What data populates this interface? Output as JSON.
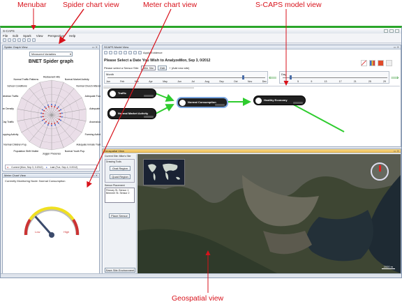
{
  "callouts": {
    "menubar": "Menubar",
    "spider": "Spider chart view",
    "meter": "Meter chart view",
    "scaps": "S-CAPS model view",
    "geo": "Geospatial view"
  },
  "app": {
    "title": "S-CAPS"
  },
  "menu": [
    "File",
    "Edit",
    "Spark",
    "View",
    "Perspective",
    "Help"
  ],
  "spider": {
    "panel_title": "Spider Graph View",
    "dropdown": "Measured Variables",
    "title": "BNET Spider graph",
    "legend_current": "Current (Mon, Sep 3, 0:2012)",
    "legend_last": "Last (Tue, Sep 4, 0:2012)",
    "axes": [
      "Restaurant Hits",
      "Normal Market Activity",
      "Normal Church Attendance",
      "Adequate Food Supply",
      "Adequate Fuel",
      "Anomalous",
      "Farming Activity",
      "Adequate Inmate Training",
      "Normal Youth Pop.",
      "Jogger Presence",
      "Population Shift Visible",
      "Normal Children Pop.",
      "Shopping Activity",
      "Day Traffic",
      "Pedestrian Density",
      "Pedestrian Traffic",
      "School Conditions",
      "Normal Traffic Patterns"
    ],
    "colors": {
      "current": "#cc3333",
      "last": "#4466cc",
      "fill": "#d9c3d6"
    }
  },
  "meter": {
    "panel_title": "Meter Chart View",
    "monitoring": "Currently Monitoring Node: Normal Consumption",
    "low": "Low",
    "high": "High",
    "level": 0.27
  },
  "model": {
    "panel_title": "SCAPS Model View",
    "toolbar_label": "Apply Evidence",
    "prompt": "Please Select a Date You Wish to Analyze:",
    "date": "Mon, Sep 3, 0/2012",
    "sensor_label": "Please select a Sensor Site:",
    "sensor_value": "Mile Site",
    "edit": "Edit",
    "add_site": "+ (Add new site)",
    "month_label": "Month",
    "day_label": "Day",
    "months": [
      "Jan",
      "Feb",
      "Mar",
      "Apr",
      "May",
      "Jun",
      "Jul",
      "Aug",
      "Sep",
      "Oct",
      "Nov",
      "Dec"
    ],
    "days": [
      "1",
      "5",
      "9",
      "13",
      "17",
      "21",
      "25",
      "29"
    ],
    "nodes": {
      "traffic": "Traffic",
      "market": "Normal Market Activity",
      "consumption": "Normal Consumption",
      "economy": "Healthy Economy"
    }
  },
  "geo": {
    "panel_title": "Geospatial View",
    "site_label": "Current Site: Mike's Site",
    "drawing_tools": "Drawing Tools",
    "oval": "Oval Region",
    "quad": "Quad Region",
    "placement_label": "Sensor Placement",
    "placements": [
      "Primary St. Sensor 1",
      "Brimmer St. Sensor 2"
    ],
    "place_button": "Place Sensor",
    "save_button": "Save Site Environment",
    "scale": "2000 m"
  }
}
